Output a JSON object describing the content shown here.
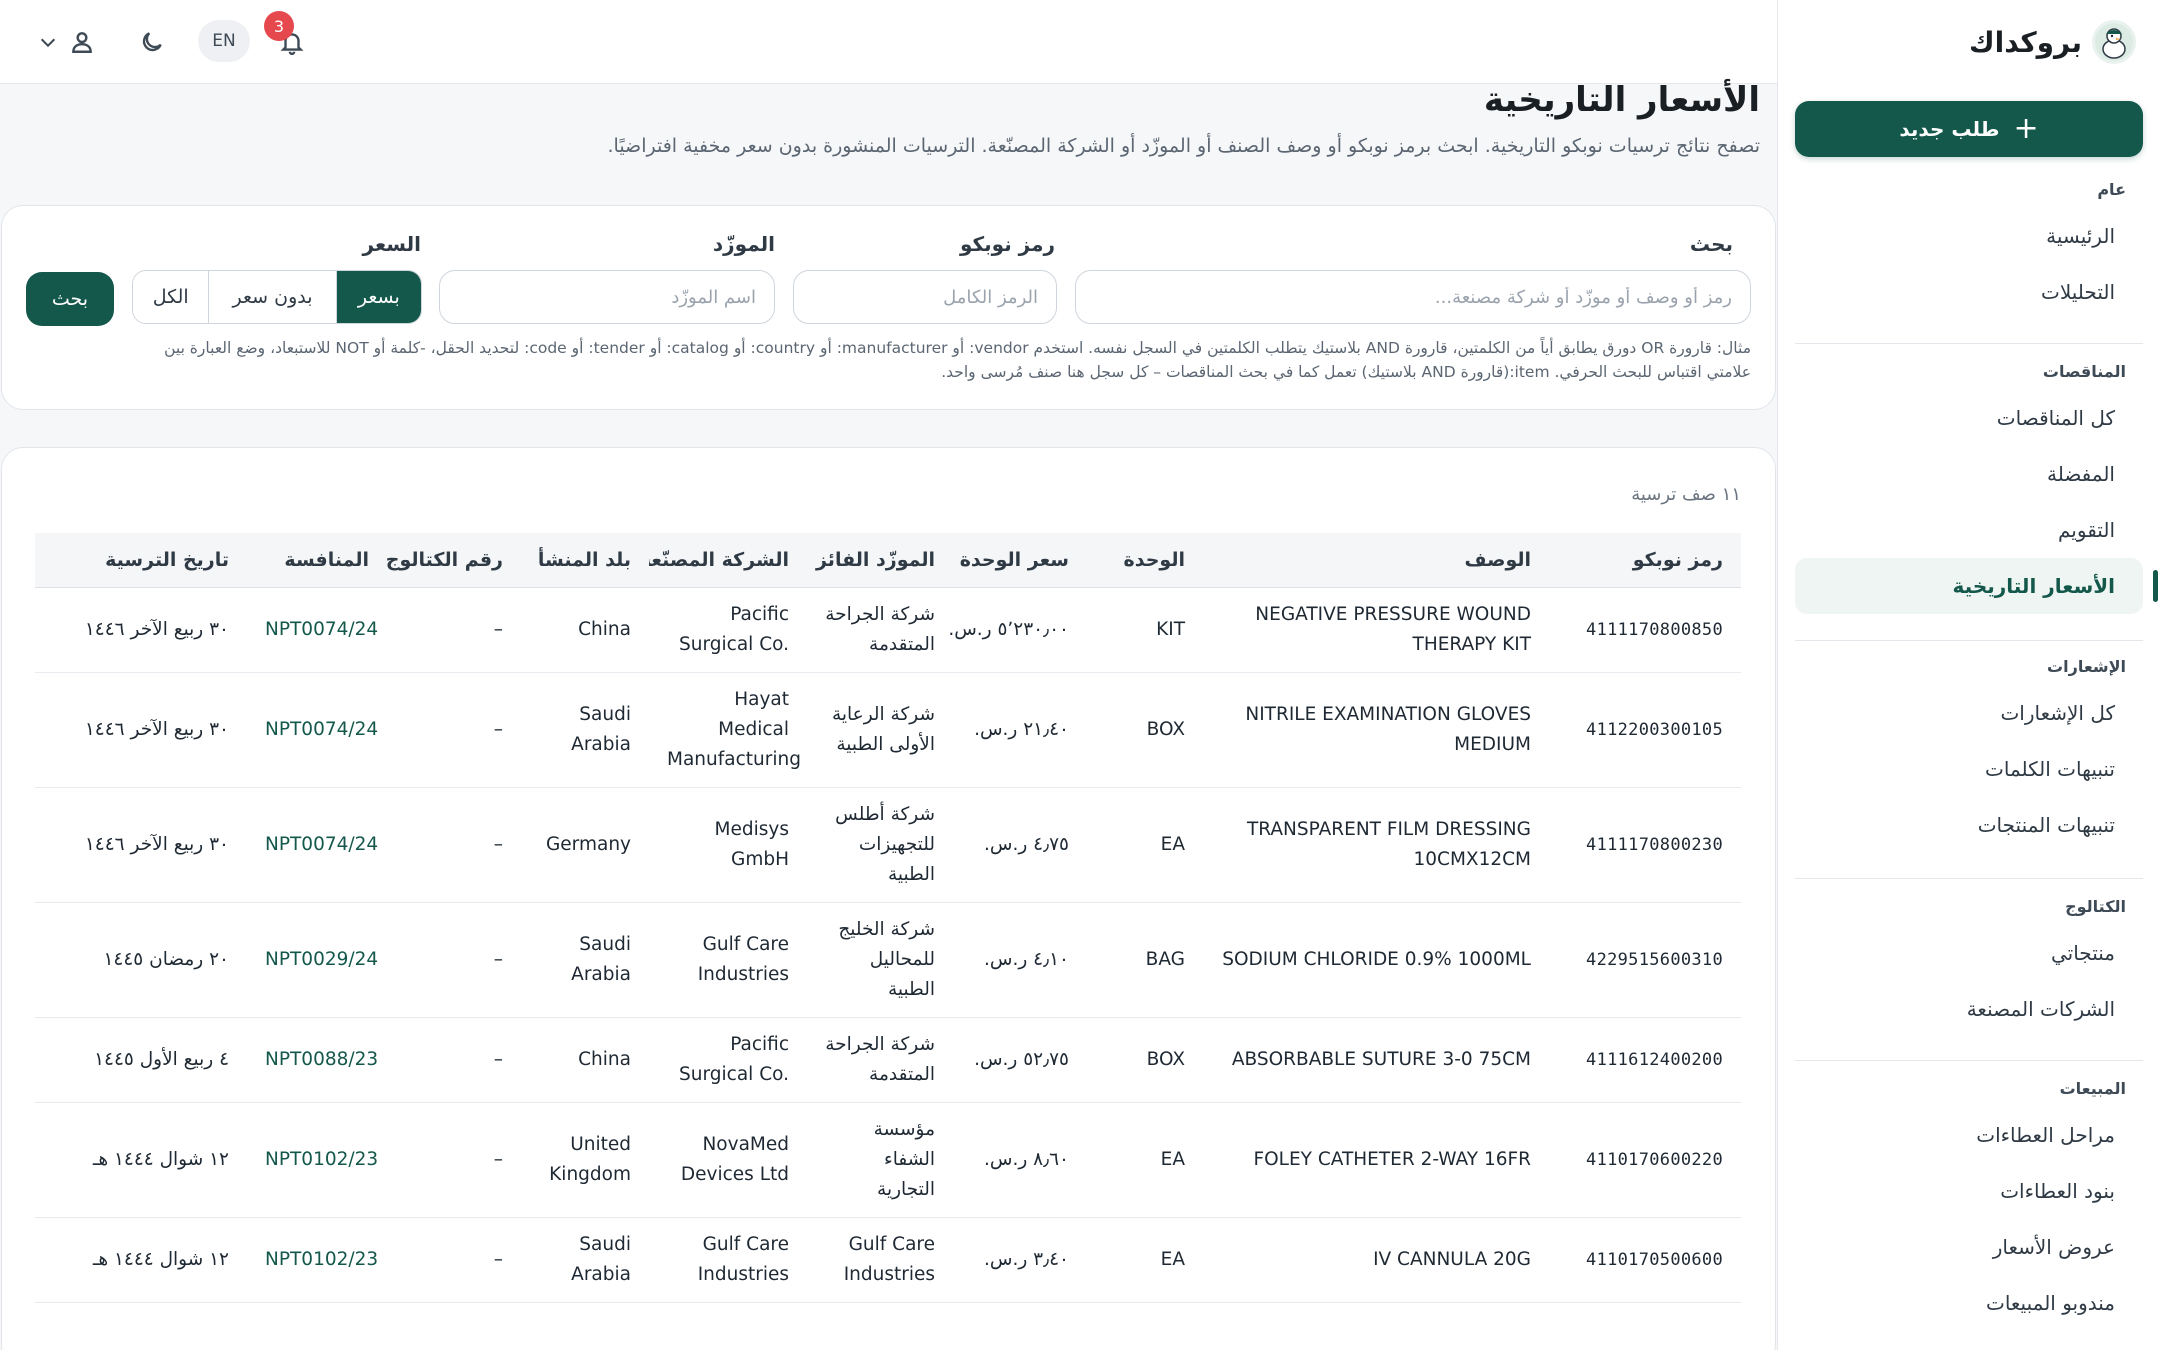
{
  "app": {
    "name": "بروكداك"
  },
  "sidebar": {
    "new_button": "طلب جديد",
    "sections": [
      {
        "heading": "عام",
        "items": [
          {
            "label": "الرئيسية",
            "active": false
          },
          {
            "label": "التحليلات",
            "active": false
          }
        ]
      },
      {
        "heading": "المناقصات",
        "items": [
          {
            "label": "كل المناقصات",
            "active": false
          },
          {
            "label": "المفضلة",
            "active": false
          },
          {
            "label": "التقويم",
            "active": false
          },
          {
            "label": "الأسعار التاريخية",
            "active": true
          }
        ]
      },
      {
        "heading": "الإشعارات",
        "items": [
          {
            "label": "كل الإشعارات",
            "active": false
          },
          {
            "label": "تنبيهات الكلمات",
            "active": false
          },
          {
            "label": "تنبيهات المنتجات",
            "active": false
          }
        ]
      },
      {
        "heading": "الكتالوج",
        "items": [
          {
            "label": "منتجاتي",
            "active": false
          },
          {
            "label": "الشركات المصنعة",
            "active": false
          }
        ]
      },
      {
        "heading": "المبيعات",
        "items": [
          {
            "label": "مراحل العطاءات",
            "active": false
          },
          {
            "label": "بنود العطاءات",
            "active": false
          },
          {
            "label": "عروض الأسعار",
            "active": false
          },
          {
            "label": "مندوبو المبيعات",
            "active": false
          }
        ]
      }
    ]
  },
  "topbar": {
    "notification_count": "3",
    "language": "EN"
  },
  "page": {
    "title": "الأسعار التاريخية",
    "subtitle": "تصفح نتائج ترسيات نوبكو التاريخية. ابحث برمز نوبكو أو وصف الصنف أو الموزّد أو الشركة المصنّعة. الترسيات المنشورة بدون سعر مخفية افتراضيًا."
  },
  "filters": {
    "search_label": "بحث",
    "search_placeholder": "رمز أو وصف أو موزّد أو شركة مصنعة...",
    "code_label": "رمز نوبكو",
    "code_placeholder": "الرمز الكامل",
    "supplier_label": "الموزّد",
    "supplier_placeholder": "اسم الموزّد",
    "price_label": "السعر",
    "price_options": [
      "بسعر",
      "بدون سعر",
      "الكل"
    ],
    "price_selected": "بسعر",
    "search_button": "بحث",
    "hint_line1": "مثال: قارورة OR دورق يطابق أياً من الكلمتين، قارورة AND بلاستيك يتطلب الكلمتين في السجل نفسه. استخدم vendor: أو manufacturer: أو country: أو catalog: أو tender: أو code: لتحديد الحقل، -كلمة أو NOT للاستبعاد، وضع العبارة بين",
    "hint_line2": "علامتي اقتباس للبحث الحرفي. item:(قارورة AND بلاستيك) تعمل كما في بحث المناقصات – كل سجل هنا صنف مُرسى واحد."
  },
  "table": {
    "row_count": "١١ صف ترسية",
    "columns": [
      "رمز نوبكو",
      "الوصف",
      "الوحدة",
      "سعر الوحدة",
      "الموزّد الفائز",
      "الشركة المصنّعة",
      "بلد المنشأ",
      "رقم الكتالوج",
      "المنافسة",
      "تاريخ الترسية"
    ],
    "rows": [
      [
        "4111170800850",
        "NEGATIVE PRESSURE WOUND THERAPY KIT",
        "KIT",
        "٥٬٢٣٠٫٠٠ ر.س.",
        "شركة الجراحة المتقدمة",
        "Pacific Surgical Co.",
        "China",
        "–",
        "NPT0074/24",
        "٣٠ ربيع الآخر ١٤٤٦"
      ],
      [
        "4112200300105",
        "NITRILE EXAMINATION GLOVES MEDIUM",
        "BOX",
        "٢١٫٤٠ ر.س.",
        "شركة الرعاية الأولى الطبية",
        "Hayat Medical Manufacturing",
        "Saudi Arabia",
        "–",
        "NPT0074/24",
        "٣٠ ربيع الآخر ١٤٤٦"
      ],
      [
        "4111170800230",
        "TRANSPARENT FILM DRESSING 10CMX12CM",
        "EA",
        "٤٫٧٥ ر.س.",
        "شركة أطلس للتجهيزات الطبية",
        "Medisys GmbH",
        "Germany",
        "–",
        "NPT0074/24",
        "٣٠ ربيع الآخر ١٤٤٦"
      ],
      [
        "4229515600310",
        "SODIUM CHLORIDE 0.9% 1000ML",
        "BAG",
        "٤٫١٠ ر.س.",
        "شركة الخليج للمحاليل الطبية",
        "Gulf Care Industries",
        "Saudi Arabia",
        "–",
        "NPT0029/24",
        "٢٠ رمضان ١٤٤٥"
      ],
      [
        "4111612400200",
        "ABSORBABLE SUTURE 3-0 75CM",
        "BOX",
        "٥٢٫٧٥ ر.س.",
        "شركة الجراحة المتقدمة",
        "Pacific Surgical Co.",
        "China",
        "–",
        "NPT0088/23",
        "٤ ربيع الأول ١٤٤٥"
      ],
      [
        "4110170600220",
        "FOLEY CATHETER 2-WAY 16FR",
        "EA",
        "٨٫٦٠ ر.س.",
        "مؤسسة الشفاء التجارية",
        "NovaMed Devices Ltd",
        "United Kingdom",
        "–",
        "NPT0102/23",
        "١٢ شوال ١٤٤٤ هـ"
      ],
      [
        "4110170500600",
        "IV CANNULA 20G",
        "EA",
        "٣٫٤٠ ر.س.",
        "Gulf Care Industries",
        "Gulf Care Industries",
        "Saudi Arabia",
        "–",
        "NPT0102/23",
        "١٢ شوال ١٤٤٤ هـ"
      ]
    ]
  },
  "colors": {
    "primary": "#14584c",
    "badge": "#e5484d",
    "link": "#14584c"
  }
}
